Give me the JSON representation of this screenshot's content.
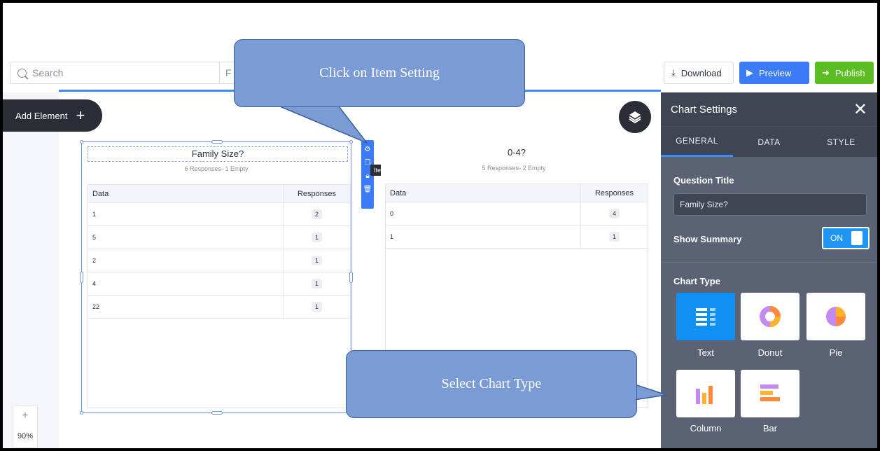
{
  "toolbar": {
    "search_placeholder": "Search",
    "form_input_prefix": "F",
    "download_label": "Download",
    "preview_label": "Preview",
    "publish_label": "Publish"
  },
  "canvas": {
    "add_element_label": "Add Element",
    "zoom_plus": "+",
    "zoom_value": "90%",
    "item_settings_tooltip": "Item Settings"
  },
  "card_left": {
    "title": "Family Size?",
    "subtitle": "6 Responses- 1 Empty",
    "col_data": "Data",
    "col_responses": "Responses",
    "rows": [
      {
        "data": "1",
        "responses": "2"
      },
      {
        "data": "5",
        "responses": "1"
      },
      {
        "data": "2",
        "responses": "1"
      },
      {
        "data": "4",
        "responses": "1"
      },
      {
        "data": "22",
        "responses": "1"
      }
    ]
  },
  "card_right": {
    "title": "0-4?",
    "subtitle": "5 Responses- 2 Empty",
    "col_data": "Data",
    "col_responses": "Responses",
    "rows": [
      {
        "data": "0",
        "responses": "4"
      },
      {
        "data": "1",
        "responses": "1"
      }
    ]
  },
  "panel": {
    "title": "Chart Settings",
    "tabs": [
      "GENERAL",
      "DATA",
      "STYLE"
    ],
    "question_title_label": "Question Title",
    "question_title_value": "Family Size?",
    "show_summary_label": "Show Summary",
    "show_summary_state": "ON",
    "chart_type_label": "Chart Type",
    "chart_types": [
      "Text",
      "Donut",
      "Pie",
      "Column",
      "Bar"
    ]
  },
  "callouts": {
    "item_setting": "Click on Item Setting",
    "chart_type": "Select Chart Type"
  },
  "colors": {
    "accent_blue": "#3b7cf6",
    "publish_green": "#5bbd23",
    "panel_bg": "#5a6273",
    "callout_fill": "#7b9bd5"
  }
}
